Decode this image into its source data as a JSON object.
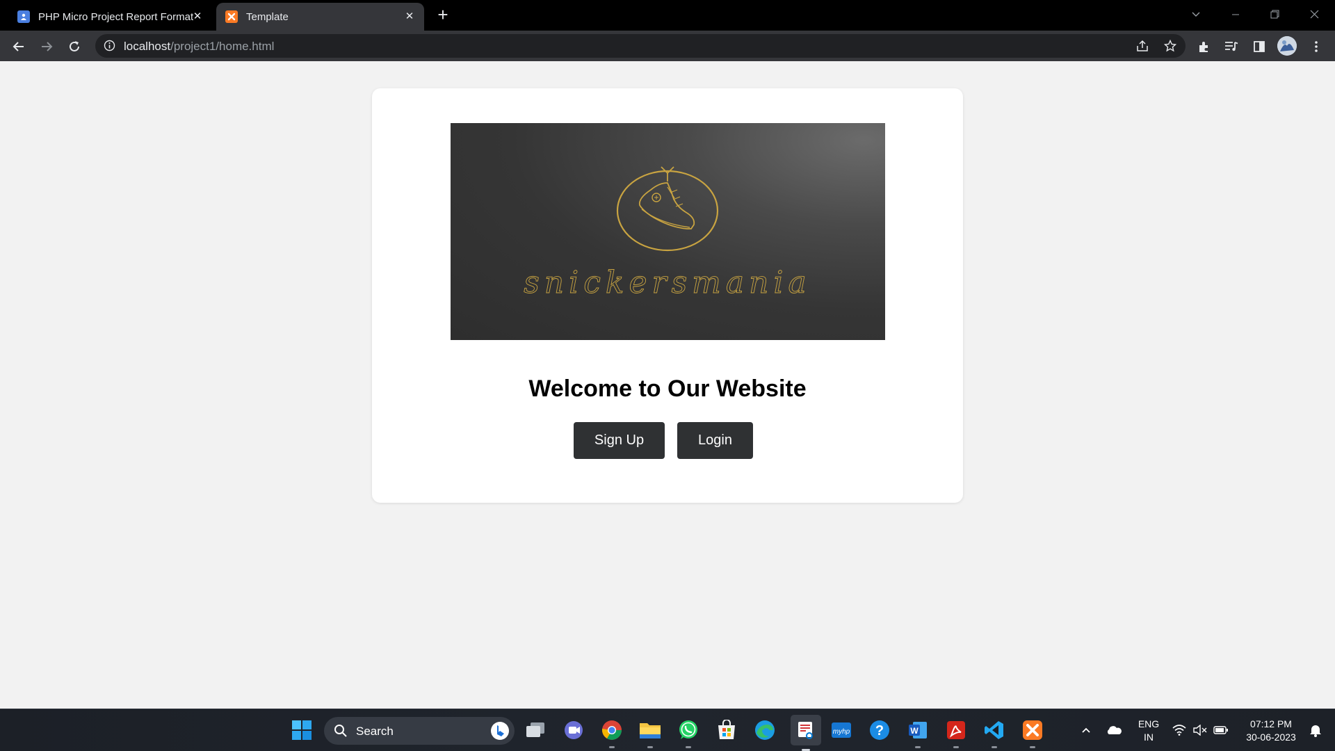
{
  "browser": {
    "tabs": [
      {
        "title": "PHP Micro Project Report Format",
        "icon": "google-docs-icon",
        "active": false
      },
      {
        "title": "Template",
        "icon": "xampp-icon",
        "active": true
      }
    ],
    "url_host": "localhost",
    "url_path": "/project1/home.html"
  },
  "page": {
    "logo_text": "snickersmania",
    "heading": "Welcome to Our Website",
    "signup_label": "Sign Up",
    "login_label": "Login"
  },
  "taskbar": {
    "search_label": "Search",
    "language_line1": "ENG",
    "language_line2": "IN",
    "time": "07:12 PM",
    "date": "30-06-2023",
    "apps": [
      "start",
      "task-view",
      "teams",
      "chrome",
      "file-explorer",
      "whatsapp",
      "microsoft-store",
      "edge",
      "snipping-tool",
      "myhp",
      "get-help",
      "word",
      "acrobat",
      "vs-code",
      "xampp"
    ]
  },
  "colors": {
    "page_bg": "#f2f2f2",
    "button_bg": "#2f3133",
    "logo_gold": "#c9a441"
  }
}
